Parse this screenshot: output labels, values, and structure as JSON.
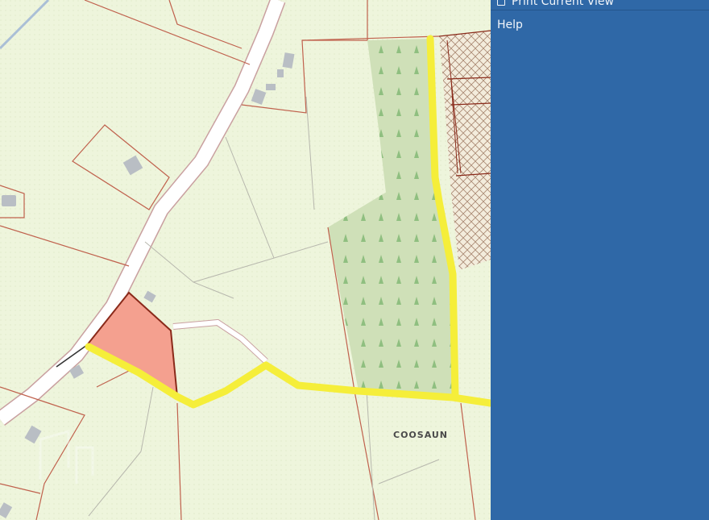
{
  "map": {
    "place_label": "COOSAUN",
    "colors": {
      "background": "#eef5dc",
      "field_boundary": "#c0614d",
      "road": "#ffffff",
      "road_edge": "#c9a0a0",
      "forest": "#cfe0b8",
      "tree_symbol": "#8fbf80",
      "site": "#f4a08f",
      "site_outline": "#8a2a1a",
      "access_route": "#f5ee3a",
      "building": "#b9bec4",
      "hatched_area": "#f3ecdc"
    }
  },
  "panel": {
    "menu": {
      "print_label": "Print Current View",
      "help_label": "Help"
    },
    "icons": {
      "print": "print-icon"
    },
    "background": "#2f68a7"
  }
}
